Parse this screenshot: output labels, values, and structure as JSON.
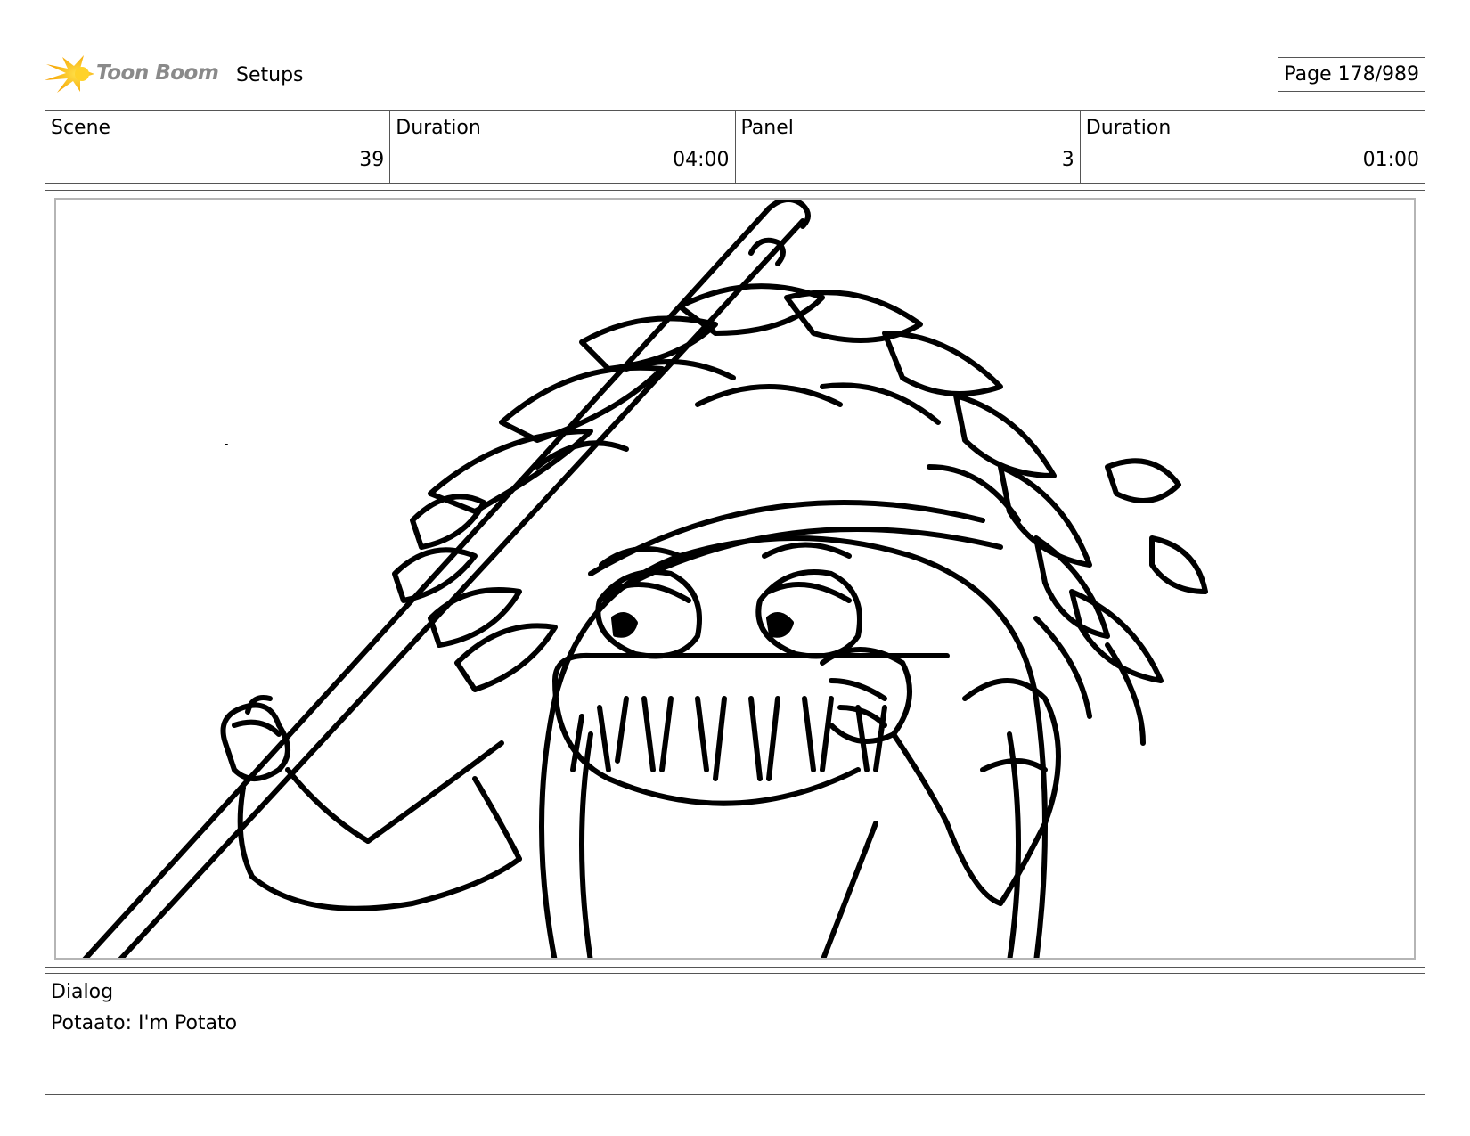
{
  "header": {
    "logo_text": "Toon Boom",
    "section": "Setups",
    "page": "Page 178/989"
  },
  "info": {
    "scene_label": "Scene",
    "scene_value": "39",
    "scene_duration_label": "Duration",
    "scene_duration_value": "04:00",
    "panel_label": "Panel",
    "panel_value": "3",
    "panel_duration_label": "Duration",
    "panel_duration_value": "01:00"
  },
  "dialog": {
    "label": "Dialog",
    "text": "Potaato: I'm Potato"
  },
  "colors": {
    "logo_orange": "#f5a800",
    "logo_yellow": "#ffd400",
    "logo_text": "#8a8a8a",
    "border": "#555555",
    "panel_border": "#b5b5b5"
  }
}
